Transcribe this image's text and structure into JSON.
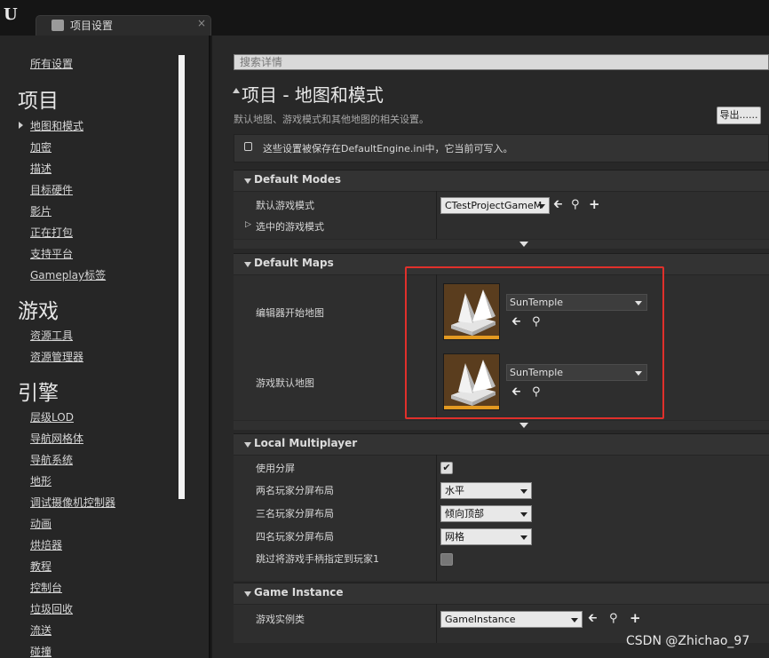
{
  "tab": {
    "title": "项目设置",
    "close": "×"
  },
  "nav": {
    "all_settings": "所有设置",
    "sections": [
      {
        "title": "项目",
        "items": [
          "地图和模式",
          "加密",
          "描述",
          "目标硬件",
          "影片",
          "正在打包",
          "支持平台",
          "Gameplay标签"
        ]
      },
      {
        "title": "游戏",
        "items": [
          "资源工具",
          "资源管理器"
        ]
      },
      {
        "title": "引擎",
        "items": [
          "层级LOD",
          "导航网格体",
          "导航系统",
          "地形",
          "调试摄像机控制器",
          "动画",
          "烘焙器",
          "教程",
          "控制台",
          "垃圾回收",
          "流送",
          "碰撞"
        ]
      }
    ]
  },
  "search": {
    "placeholder": "搜索详情"
  },
  "page": {
    "title": "项目 - 地图和模式",
    "description": "默认地图、游戏模式和其他地图的相关设置。",
    "export_label": "导出......",
    "notice": "这些设置被保存在DefaultEngine.ini中，它当前可写入。"
  },
  "categories": {
    "default_modes": {
      "title": "Default Modes",
      "default_game_mode_label": "默认游戏模式",
      "default_game_mode_value": "CTestProjectGameM",
      "selected_game_mode_label": "选中的游戏模式"
    },
    "default_maps": {
      "title": "Default Maps",
      "editor_startup_map_label": "编辑器开始地图",
      "editor_startup_map_value": "SunTemple",
      "game_default_map_label": "游戏默认地图",
      "game_default_map_value": "SunTemple"
    },
    "local_multiplayer": {
      "title": "Local Multiplayer",
      "use_splitscreen_label": "使用分屏",
      "use_splitscreen_checked": true,
      "two_player_label": "两名玩家分屏布局",
      "two_player_value": "水平",
      "three_player_label": "三名玩家分屏布局",
      "three_player_value": "倾向顶部",
      "four_player_label": "四名玩家分屏布局",
      "four_player_value": "网格",
      "skip_gamepad_label": "跳过将游戏手柄指定到玩家1",
      "skip_gamepad_checked": false
    },
    "game_instance": {
      "title": "Game Instance",
      "game_instance_class_label": "游戏实例类",
      "game_instance_class_value": "GameInstance"
    }
  },
  "watermark": "CSDN @Zhichao_97",
  "colors": {
    "highlight_box": "#e0302b",
    "thumbnail_accent": "#e49a21"
  }
}
